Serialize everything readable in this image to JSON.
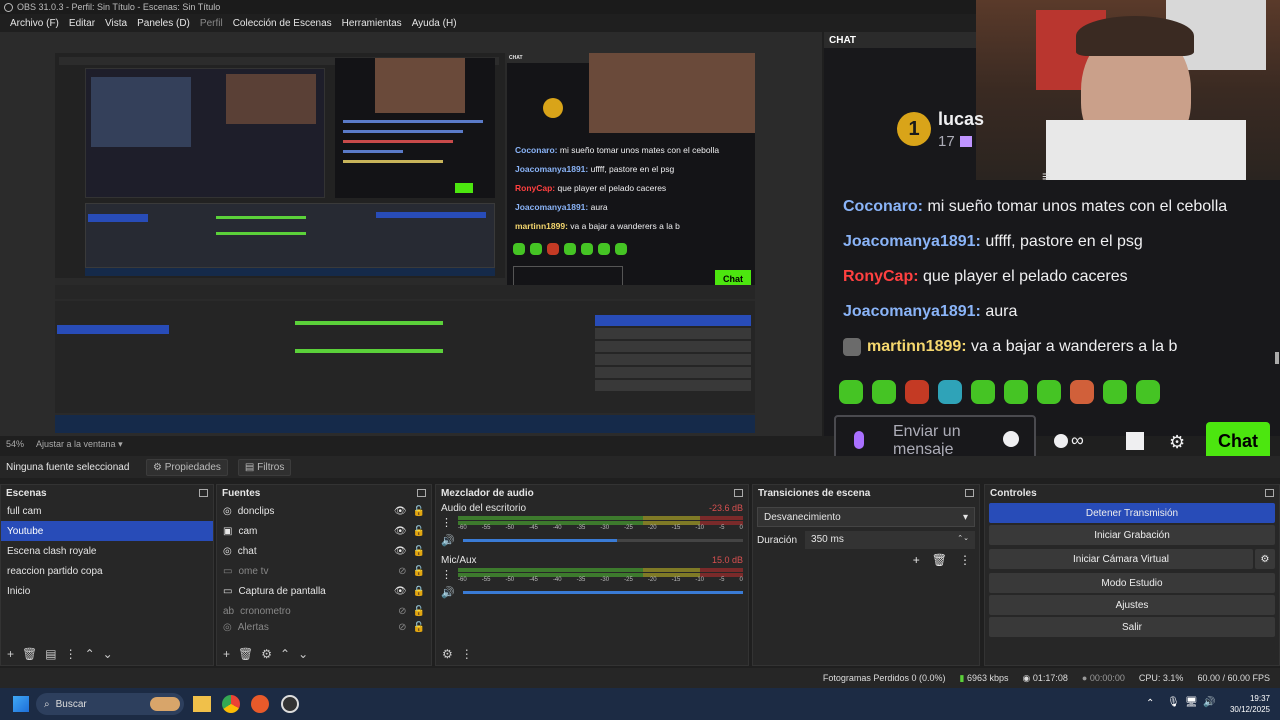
{
  "window": {
    "title": "OBS 31.0.3 - Perfil: Sin Título - Escenas: Sin Título"
  },
  "menu": [
    {
      "label": "Archivo (F)",
      "dim": false
    },
    {
      "label": "Editar",
      "dim": false
    },
    {
      "label": "Vista",
      "dim": false
    },
    {
      "label": "Paneles (D)",
      "dim": false
    },
    {
      "label": "Perfil",
      "dim": true
    },
    {
      "label": "Colección de Escenas",
      "dim": false
    },
    {
      "label": "Herramientas",
      "dim": false
    },
    {
      "label": "Ayuda (H)",
      "dim": false
    }
  ],
  "chat": {
    "header": "CHAT",
    "streamer": "lucas",
    "rank": "1",
    "count": "17",
    "messages": [
      {
        "user": "Coconaro",
        "color": "blue",
        "text": "mi sueño tomar unos mates con el cebolla"
      },
      {
        "user": "Joacomanya1891",
        "color": "blue",
        "text": "uffff, pastore en el psg"
      },
      {
        "user": "RonyCap",
        "color": "red",
        "text": "que player el pelado caceres"
      },
      {
        "user": "Joacomanya1891",
        "color": "blue",
        "text": "aura"
      },
      {
        "user": "martinn1899",
        "color": "yellow",
        "text": "va a bajar a wanderers a la b"
      }
    ],
    "input_placeholder": "Enviar un mensaje",
    "infinity": "∞",
    "send_label": "Chat"
  },
  "preview": {
    "zoom": "54%",
    "fit_label": "Ajustar a la ventana"
  },
  "source_toolbar": {
    "no_source": "Ninguna fuente seleccionad",
    "properties": "Propiedades",
    "filters": "Filtros"
  },
  "scenes": {
    "title": "Escenas",
    "items": [
      "full cam",
      "Youtube",
      "Escena clash royale",
      "reaccion partido copa",
      "Inicio"
    ],
    "selected": "Youtube"
  },
  "sources": {
    "title": "Fuentes",
    "items": [
      {
        "label": "donclips",
        "visible": true,
        "locked": false
      },
      {
        "label": "cam",
        "visible": true,
        "locked": false
      },
      {
        "label": "chat",
        "visible": true,
        "locked": false
      },
      {
        "label": "ome tv",
        "visible": false,
        "locked": false
      },
      {
        "label": "Captura de pantalla",
        "visible": true,
        "locked": true
      },
      {
        "label": "cronometro",
        "visible": false,
        "locked": false
      },
      {
        "label": "Alertas",
        "visible": false,
        "locked": false
      }
    ]
  },
  "mixer": {
    "title": "Mezclador de audio",
    "channels": [
      {
        "name": "Audio del escritorio",
        "db": "-23.6 dB",
        "level": 0.62,
        "volume": 0.55
      },
      {
        "name": "Mic/Aux",
        "db": "15.0 dB",
        "level": 0.8,
        "volume": 1.0
      }
    ],
    "scale": [
      "-60",
      "-55",
      "-50",
      "-45",
      "-40",
      "-35",
      "-30",
      "-25",
      "-20",
      "-15",
      "-10",
      "-5",
      "0"
    ]
  },
  "transitions": {
    "title": "Transiciones de escena",
    "selected": "Desvanecimiento",
    "duration_label": "Duración",
    "duration_value": "350 ms"
  },
  "controls": {
    "title": "Controles",
    "buttons": [
      {
        "label": "Detener Transmisión",
        "active": true
      },
      {
        "label": "Iniciar Grabación",
        "active": false
      },
      {
        "label": "Iniciar Cámara Virtual",
        "active": false
      },
      {
        "label": "Modo Estudio",
        "active": false
      },
      {
        "label": "Ajustes",
        "active": false
      },
      {
        "label": "Salir",
        "active": false
      }
    ]
  },
  "status": {
    "frames": "Fotogramas Perdidos 0 (0.0%)",
    "kbps": "6963 kbps",
    "stream_time": "01:17:08",
    "rec_time": "00:00:00",
    "cpu": "CPU: 3.1%",
    "fps": "60.00 / 60.00 FPS"
  },
  "taskbar": {
    "search": "Buscar",
    "time": "19:37",
    "date": "30/12/2025"
  },
  "colors": {
    "accent": "#284cb8",
    "twitch_green": "#4ce60f",
    "chat_bg": "#18181b",
    "live_red": "#ff4040"
  }
}
